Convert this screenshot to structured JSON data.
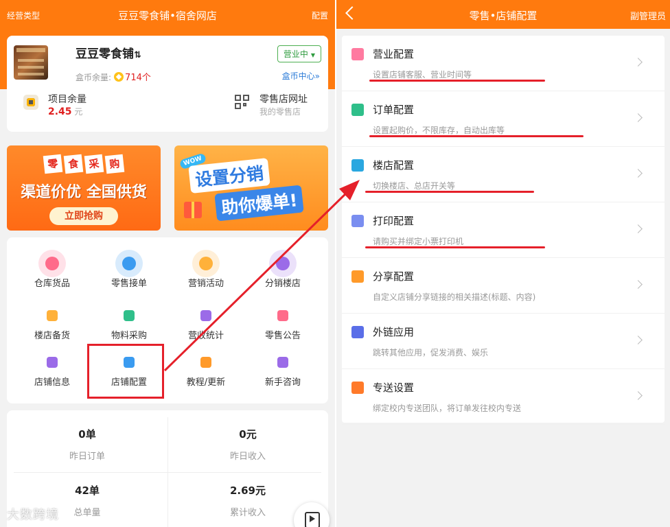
{
  "left": {
    "header": {
      "biz_type": "经营类型",
      "title": "豆豆零食铺•宿舍网店",
      "config": "配置"
    },
    "shop": {
      "name": "豆豆零食铺",
      "sort_glyph": "⇅",
      "coin_label": "盒币余量:",
      "coin_value": "714个",
      "status": "营业中",
      "coin_center": "盒币中心»",
      "stats": [
        {
          "label": "项目余量",
          "value": "2.45",
          "unit": "元"
        },
        {
          "label": "零售店网址",
          "sub": "我的零售店"
        }
      ]
    },
    "banners": {
      "b1": {
        "tags": [
          "零",
          "食",
          "采",
          "购"
        ],
        "main": "渠道价优 全国供货",
        "button": "立即抢购"
      },
      "b2": {
        "wow": "WOW",
        "line1": "设置分销",
        "line2": "助你爆单!"
      }
    },
    "grid": [
      {
        "label": "仓库货品",
        "icon": "lollipop-icon",
        "color": "#ff6b8a"
      },
      {
        "label": "零售接单",
        "icon": "order-list-icon",
        "color": "#3a9bf0"
      },
      {
        "label": "营销活动",
        "icon": "star-badge-icon",
        "color": "#ffb13a"
      },
      {
        "label": "分销楼店",
        "icon": "building-share-icon",
        "color": "#9b6be8"
      },
      {
        "label": "楼店备货",
        "icon": "box-icon",
        "color": "#ffb13a"
      },
      {
        "label": "物料采购",
        "icon": "basket-icon",
        "color": "#2fbf8a"
      },
      {
        "label": "营收统计",
        "icon": "chart-person-icon",
        "color": "#9b6be8"
      },
      {
        "label": "零售公告",
        "icon": "announcement-icon",
        "color": "#ff6b8a"
      },
      {
        "label": "店铺信息",
        "icon": "shop-info-icon",
        "color": "#9b6be8"
      },
      {
        "label": "店铺配置",
        "icon": "gear-icon",
        "color": "#3a9bf0"
      },
      {
        "label": "教程/更新",
        "icon": "tutorial-icon",
        "color": "#ff9a2a"
      },
      {
        "label": "新手咨询",
        "icon": "help-book-icon",
        "color": "#9b6be8"
      }
    ],
    "stats": [
      {
        "value": "0单",
        "label": "昨日订单"
      },
      {
        "value": "0元",
        "label": "昨日收入"
      },
      {
        "value": "42单",
        "label": "总单量"
      },
      {
        "value": "2.69元",
        "label": "累计收入"
      }
    ],
    "watermark": "大数跨境"
  },
  "right": {
    "header": {
      "title": "零售•店铺配置",
      "admin": "副管理员"
    },
    "menu": [
      {
        "title": "营业配置",
        "desc": "设置店铺客服、营业时间等",
        "icon": "open-sign-icon",
        "color": "#ff7aa0"
      },
      {
        "title": "订单配置",
        "desc": "设置起购价，不限库存，自动出库等",
        "icon": "database-icon",
        "color": "#2fbf8a"
      },
      {
        "title": "楼店配置",
        "desc": "切换楼店、总店开关等",
        "icon": "store-icon",
        "color": "#2aa7e0"
      },
      {
        "title": "打印配置",
        "desc": "请购买并绑定小票打印机",
        "icon": "receipt-icon",
        "color": "#7a8ef0"
      },
      {
        "title": "分享配置",
        "desc": "自定义店铺分享链接的相关描述(标题、内容)",
        "icon": "share-icon",
        "color": "#ff9a2a"
      },
      {
        "title": "外链应用",
        "desc": "跳转其他应用，促发消费、娱乐",
        "icon": "link-icon",
        "color": "#5a6ee8"
      },
      {
        "title": "专送设置",
        "desc": "绑定校内专送团队，将订单发往校内专送",
        "icon": "delivery-icon",
        "color": "#ff7a2a"
      }
    ]
  }
}
